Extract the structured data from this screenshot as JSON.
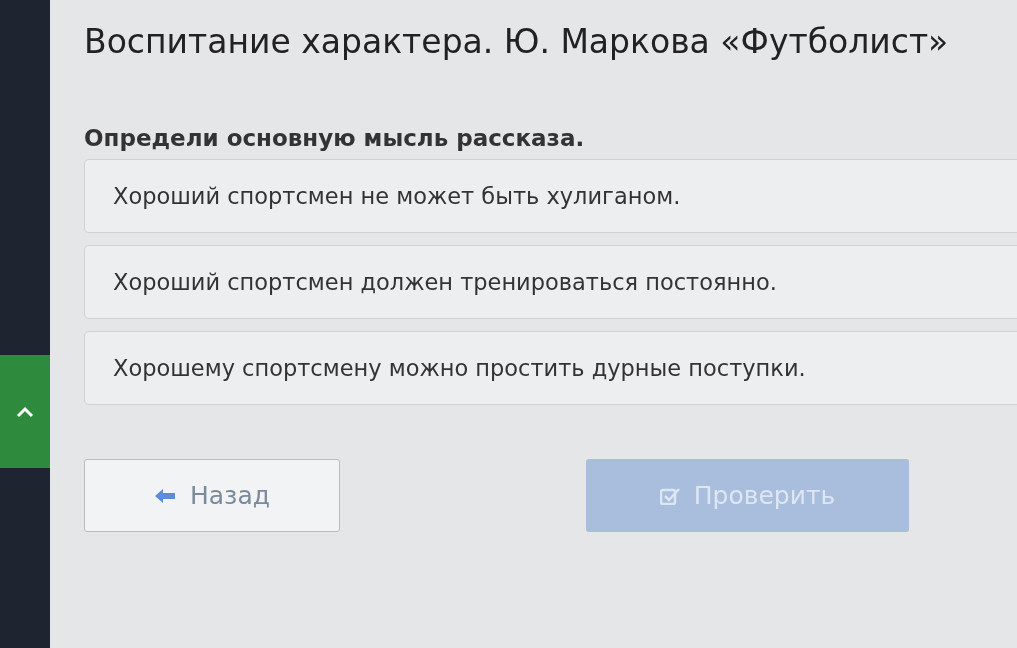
{
  "title": "Воспитание характера. Ю. Маркова «Футболист»",
  "sidebar": {
    "toggle": {
      "expanded": true
    }
  },
  "question": "Определи основную мысль рассказа.",
  "options": [
    {
      "label": "Хороший спортсмен не может быть хулиганом.",
      "selected": false
    },
    {
      "label": "Хороший спортсмен должен тренироваться постоянно.",
      "selected": false
    },
    {
      "label": "Хорошему спортсмену можно простить дурные поступки.",
      "selected": false
    }
  ],
  "back_button": {
    "label": "Назад"
  },
  "check_button": {
    "label": "Проверить",
    "disabled": true
  }
}
